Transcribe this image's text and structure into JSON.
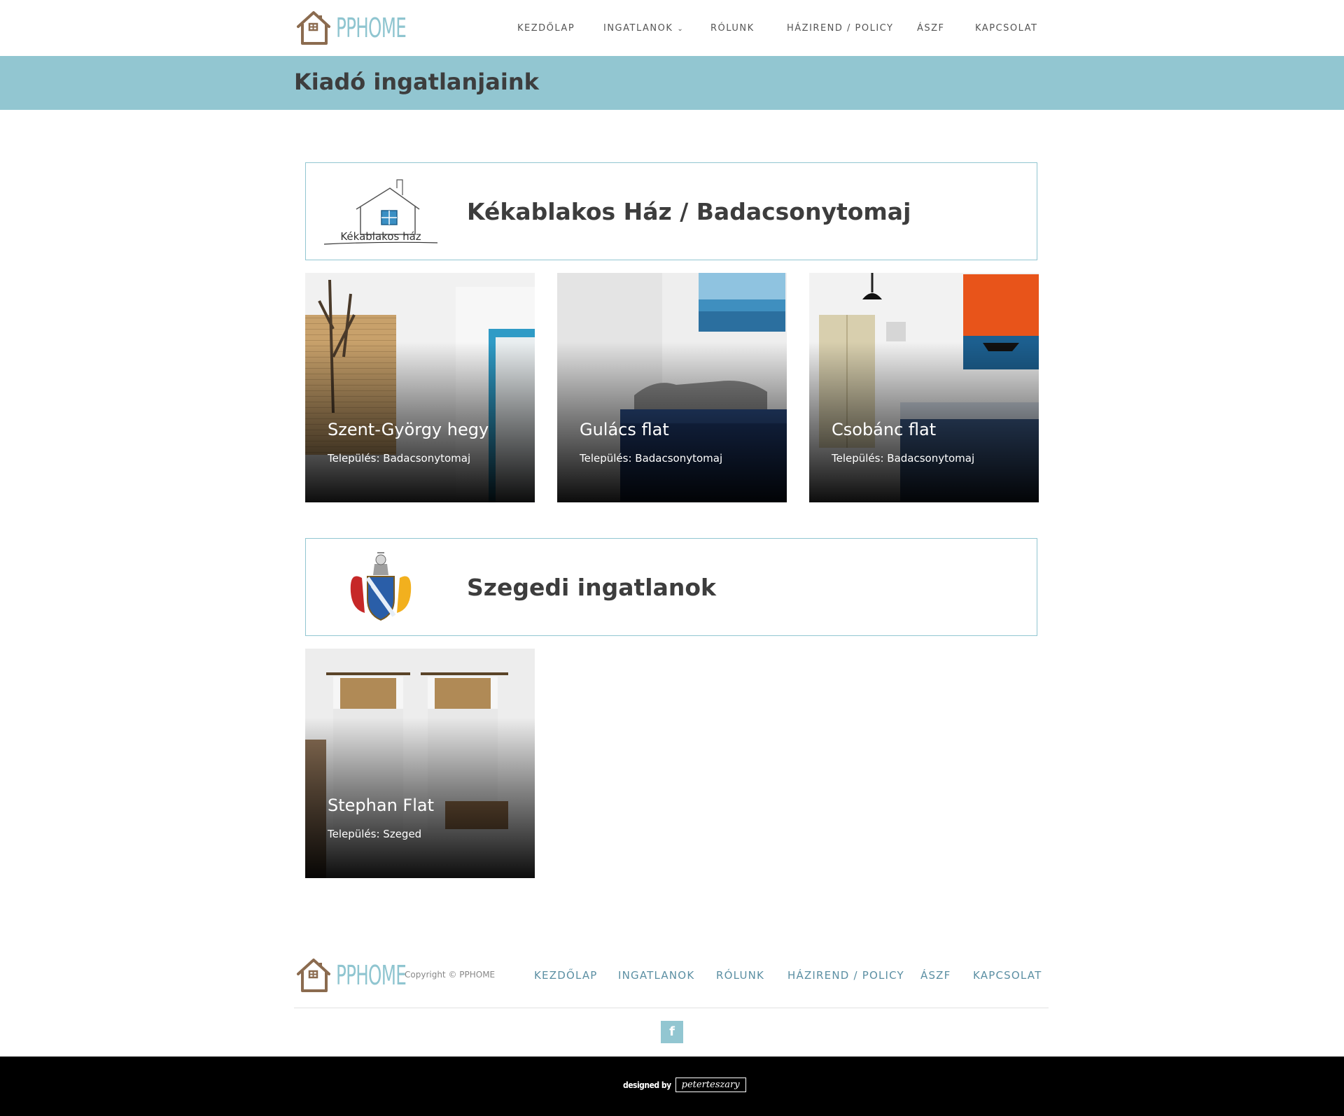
{
  "brand": {
    "name": "PPHOME"
  },
  "nav": [
    {
      "label": "KEZDŐLAP"
    },
    {
      "label": "INGATLANOK",
      "dropdown": true
    },
    {
      "label": "RÓLUNK"
    },
    {
      "label": "HÁZIREND / POLICY"
    },
    {
      "label": "ÁSZF"
    },
    {
      "label": "KAPCSOLAT"
    }
  ],
  "page": {
    "title": "Kiadó ingatlanjaink"
  },
  "sections": [
    {
      "title": "Kékablakos Ház / Badacsonytomaj",
      "logo_text": "Kékablakos ház",
      "properties": [
        {
          "name": "Szent-György hegy",
          "location": "Település: Badacsonytomaj"
        },
        {
          "name": "Gulács flat",
          "location": "Település: Badacsonytomaj"
        },
        {
          "name": "Csobánc flat",
          "location": "Település: Badacsonytomaj"
        }
      ]
    },
    {
      "title": "Szegedi ingatlanok",
      "logo_text": "",
      "properties": [
        {
          "name": "Stephan Flat",
          "location": "Település: Szeged"
        }
      ]
    }
  ],
  "footer": {
    "copyright": "Copyright © PPHOME",
    "nav": [
      "KEZDŐLAP",
      "INGATLANOK",
      "RÓLUNK",
      "HÁZIREND / POLICY",
      "ÁSZF",
      "KAPCSOLAT"
    ],
    "social": "f",
    "designed_by": "designed by",
    "designer": "peterteszary"
  },
  "colors": {
    "accent": "#92c6d1",
    "text_dark": "#3d3d3d",
    "footer_link": "#5b8fa3",
    "logo_brown": "#8b6b4f"
  },
  "icons": [
    "house-logo-icon",
    "chevron-down-icon",
    "facebook-icon"
  ]
}
